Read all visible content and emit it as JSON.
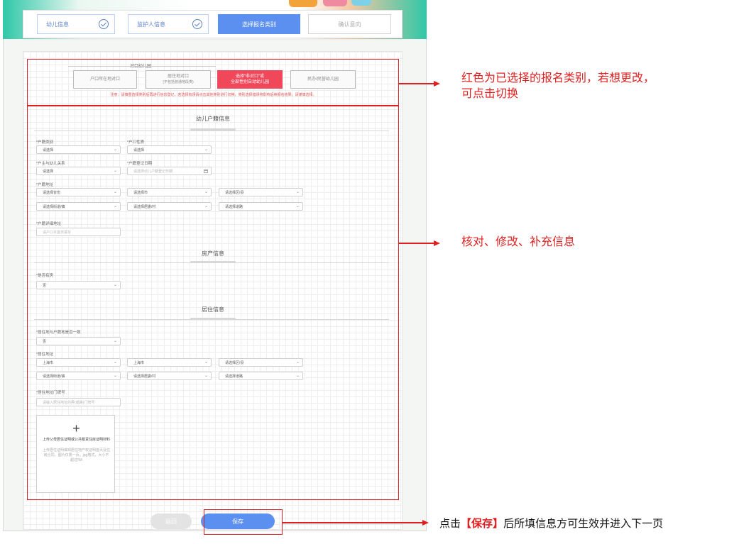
{
  "steps": [
    {
      "label": "幼儿信息",
      "state": "done"
    },
    {
      "label": "监护人信息",
      "state": "done"
    },
    {
      "label": "选择报名类别",
      "state": "active"
    },
    {
      "label": "确认意向",
      "state": "todo"
    }
  ],
  "category": {
    "group_label": "对口幼儿园",
    "options": [
      {
        "label": "户口所在地对口",
        "sub": ""
      },
      {
        "label": "居住地对口",
        "sub": "(不包括普通地段类)"
      },
      {
        "label": "选择“非对口”或",
        "sub": "全部性别自动幼儿园",
        "selected": true
      },
      {
        "label": "民办/民营幼儿园",
        "sub": ""
      }
    ],
    "notice": "注意：请慎重选择类别后再进行信息登记，若选择有误请点击其他类别进行切换，类别选择错误将影响后续报名结果，请谨慎选择。"
  },
  "sections": {
    "household": {
      "title": "幼儿户籍信息",
      "fields": {
        "hukou_type": {
          "label": "*户籍类别",
          "value": "请选择"
        },
        "hukou_nature": {
          "label": "*户口性质",
          "value": "请选择"
        },
        "relation": {
          "label": "*户主与幼儿关系",
          "value": "请选择"
        },
        "reg_date": {
          "label": "*户籍登记日期",
          "placeholder": "请选择幼儿户籍登记日期"
        },
        "address_label": "*户籍地址",
        "address": {
          "province": "请选择省份",
          "city": "请选择市",
          "district": "请选择区/县",
          "street": "请选择街道/镇",
          "community": "请选择居委/村",
          "road": "请选择道路"
        },
        "detail": {
          "label": "*户籍详细地址",
          "placeholder": "请户口本首页填写"
        }
      }
    },
    "property": {
      "title": "房产信息",
      "has_property": {
        "label": "*是否有房",
        "value": "否"
      }
    },
    "residence": {
      "title": "居住信息",
      "same_as_hukou": {
        "label": "*居住地与户籍地是否一致",
        "value": "否"
      },
      "address_label": "*居住地址",
      "address": {
        "province": "上海市",
        "city": "上海市",
        "district": "请选择区/县",
        "street": "请选择街道/镇",
        "community": "请选择居委/村",
        "road": "请选择道路"
      },
      "detail": {
        "label": "*居住地址门牌号",
        "placeholder": "请输入居住地址的弄(或路)门牌号"
      },
      "upload": {
        "plus": "+",
        "title": "上传父母居住证明或公共租赁住房证明材料",
        "hint": "上传居住证明或现居住地产权证明首页及住房合同，图片仅限一页，jpg格式，大小不超过5M"
      }
    }
  },
  "buttons": {
    "back": "返回",
    "save": "保存"
  },
  "annotations": {
    "category_line1": "红色为已选择的报名类别，若想更改，",
    "category_line2": "可点击切换",
    "verify": "核对、修改、补充信息",
    "save_pre": "点击",
    "save_bracket_open": "【",
    "save_word": "保存",
    "save_bracket_close": "】",
    "save_post": "后所填信息方可生效并进入下一页"
  },
  "colors": {
    "accent": "#5b8ff0",
    "selected_category": "#f0475a",
    "annotation": "#e02020"
  }
}
